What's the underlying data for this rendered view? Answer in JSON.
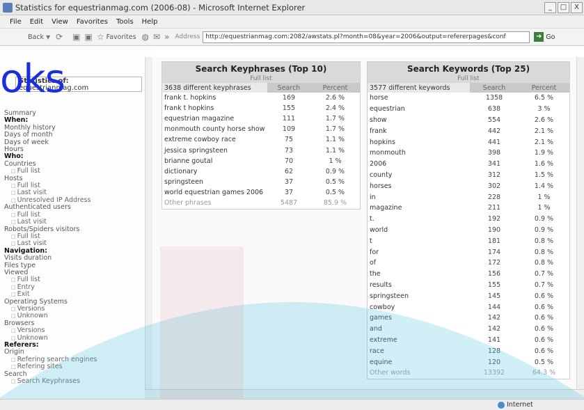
{
  "window": {
    "title": "Statistics for equestrianmag.com (2006-08) - Microsoft Internet Explorer",
    "buttons": [
      "_",
      "□",
      "X"
    ]
  },
  "menu": [
    "File",
    "Edit",
    "View",
    "Favorites",
    "Tools",
    "Help"
  ],
  "toolbar": {
    "back_label": "Back",
    "favorites_label": "Favorites",
    "address_label": "Address",
    "url": "http://equestrianmag.com:2082/awstats.pl?month=08&year=2006&output=refererpages&conf",
    "go_label": "Go"
  },
  "overlay_text": "oks",
  "left": {
    "stats_for_label": "Statistics of:",
    "site": "equestrianmag.com",
    "nav": [
      {
        "text": "Summary",
        "kind": "link"
      },
      {
        "text": "When:",
        "kind": "bold"
      },
      {
        "text": "Monthly history",
        "kind": "link"
      },
      {
        "text": "Days of month",
        "kind": "link"
      },
      {
        "text": "Days of week",
        "kind": "link"
      },
      {
        "text": "Hours",
        "kind": "link"
      },
      {
        "text": "Who:",
        "kind": "bold"
      },
      {
        "text": "Countries",
        "kind": "link"
      },
      {
        "text": "Full list",
        "kind": "sub"
      },
      {
        "text": "Hosts",
        "kind": "link"
      },
      {
        "text": "Full list",
        "kind": "sub"
      },
      {
        "text": "Last visit",
        "kind": "sub"
      },
      {
        "text": "Unresolved IP Address",
        "kind": "sub"
      },
      {
        "text": "Authenticated users",
        "kind": "link"
      },
      {
        "text": "Full list",
        "kind": "sub"
      },
      {
        "text": "Last visit",
        "kind": "sub"
      },
      {
        "text": "Robots/Spiders visitors",
        "kind": "link"
      },
      {
        "text": "Full list",
        "kind": "sub"
      },
      {
        "text": "Last visit",
        "kind": "sub"
      },
      {
        "text": "Navigation:",
        "kind": "bold"
      },
      {
        "text": "Visits duration",
        "kind": "link"
      },
      {
        "text": "Files type",
        "kind": "link"
      },
      {
        "text": "Viewed",
        "kind": "link"
      },
      {
        "text": "Full list",
        "kind": "sub"
      },
      {
        "text": "Entry",
        "kind": "sub"
      },
      {
        "text": "Exit",
        "kind": "sub"
      },
      {
        "text": "Operating Systems",
        "kind": "link"
      },
      {
        "text": "Versions",
        "kind": "sub"
      },
      {
        "text": "Unknown",
        "kind": "sub"
      },
      {
        "text": "Browsers",
        "kind": "link"
      },
      {
        "text": "Versions",
        "kind": "sub"
      },
      {
        "text": "Unknown",
        "kind": "sub"
      },
      {
        "text": "Referers:",
        "kind": "bold"
      },
      {
        "text": "Origin",
        "kind": "link"
      },
      {
        "text": "Refering search engines",
        "kind": "sub"
      },
      {
        "text": "Refering sites",
        "kind": "sub"
      },
      {
        "text": "Search",
        "kind": "link"
      },
      {
        "text": "Search Keyphrases",
        "kind": "sub"
      }
    ]
  },
  "keyphrases": {
    "title": "Search Keyphrases (Top 10)",
    "sub": "Full list",
    "header": [
      "3638 different keyphrases",
      "Search",
      "Percent"
    ],
    "rows": [
      [
        "frank t. hopkins",
        "169",
        "2.6 %"
      ],
      [
        "frank t hopkins",
        "155",
        "2.4 %"
      ],
      [
        "equestrian magazine",
        "111",
        "1.7 %"
      ],
      [
        "monmouth county horse show",
        "109",
        "1.7 %"
      ],
      [
        "extreme cowboy race",
        "75",
        "1.1 %"
      ],
      [
        "jessica springsteen",
        "73",
        "1.1 %"
      ],
      [
        "brianne goutal",
        "70",
        "1 %"
      ],
      [
        "dictionary",
        "62",
        "0.9 %"
      ],
      [
        "springsteen",
        "37",
        "0.5 %"
      ],
      [
        "world equestrian games 2006",
        "37",
        "0.5 %"
      ]
    ],
    "other": [
      "Other phrases",
      "5487",
      "85.9 %"
    ]
  },
  "keywords": {
    "title": "Search Keywords (Top 25)",
    "sub": "Full list",
    "header": [
      "3577 different keywords",
      "Search",
      "Percent"
    ],
    "rows": [
      [
        "horse",
        "1358",
        "6.5 %"
      ],
      [
        "equestrian",
        "638",
        "3 %"
      ],
      [
        "show",
        "554",
        "2.6 %"
      ],
      [
        "frank",
        "442",
        "2.1 %"
      ],
      [
        "hopkins",
        "441",
        "2.1 %"
      ],
      [
        "monmouth",
        "398",
        "1.9 %"
      ],
      [
        "2006",
        "341",
        "1.6 %"
      ],
      [
        "county",
        "312",
        "1.5 %"
      ],
      [
        "horses",
        "302",
        "1.4 %"
      ],
      [
        "in",
        "228",
        "1 %"
      ],
      [
        "magazine",
        "211",
        "1 %"
      ],
      [
        "t.",
        "192",
        "0.9 %"
      ],
      [
        "world",
        "190",
        "0.9 %"
      ],
      [
        "t",
        "181",
        "0.8 %"
      ],
      [
        "for",
        "174",
        "0.8 %"
      ],
      [
        "of",
        "172",
        "0.8 %"
      ],
      [
        "the",
        "156",
        "0.7 %"
      ],
      [
        "results",
        "155",
        "0.7 %"
      ],
      [
        "springsteen",
        "145",
        "0.6 %"
      ],
      [
        "cowboy",
        "144",
        "0.6 %"
      ],
      [
        "games",
        "142",
        "0.6 %"
      ],
      [
        "and",
        "142",
        "0.6 %"
      ],
      [
        "extreme",
        "141",
        "0.6 %"
      ],
      [
        "race",
        "128",
        "0.6 %"
      ],
      [
        "equine",
        "120",
        "0.5 %"
      ]
    ],
    "other": [
      "Other words",
      "13392",
      "64.3 %"
    ]
  },
  "status": {
    "zone": "Internet"
  }
}
